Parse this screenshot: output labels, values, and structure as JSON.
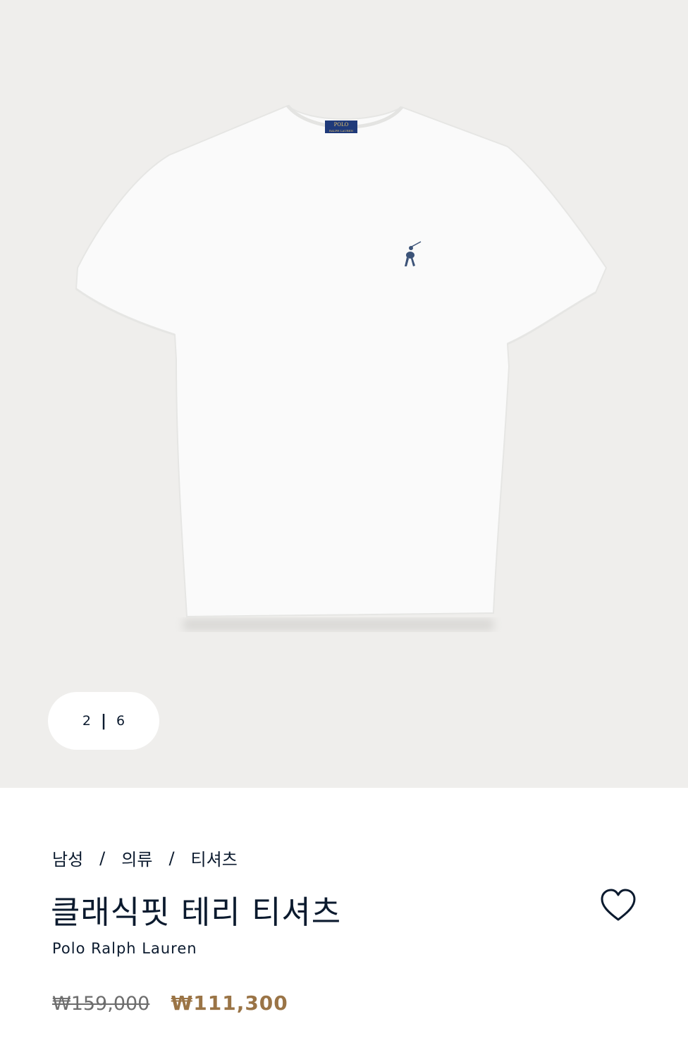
{
  "gallery": {
    "current_page": "2",
    "separator": "|",
    "total_pages": "6",
    "label_brand_line1": "POLO",
    "label_brand_line2": "RALPH LAUREN"
  },
  "breadcrumb": [
    "남성",
    "의류",
    "티셔츠"
  ],
  "breadcrumb_separator": "/",
  "product": {
    "title": "클래식핏 테리 티셔츠",
    "brand": "Polo Ralph Lauren",
    "original_price": "₩159,000",
    "sale_price": "₩111,300"
  },
  "colors": {
    "gallery_bg": "#efeeec",
    "text": "#0b1a2e",
    "sale_price": "#9a7446",
    "old_price": "#6d6d6d"
  },
  "icons": {
    "wishlist": "heart-outline-icon"
  }
}
